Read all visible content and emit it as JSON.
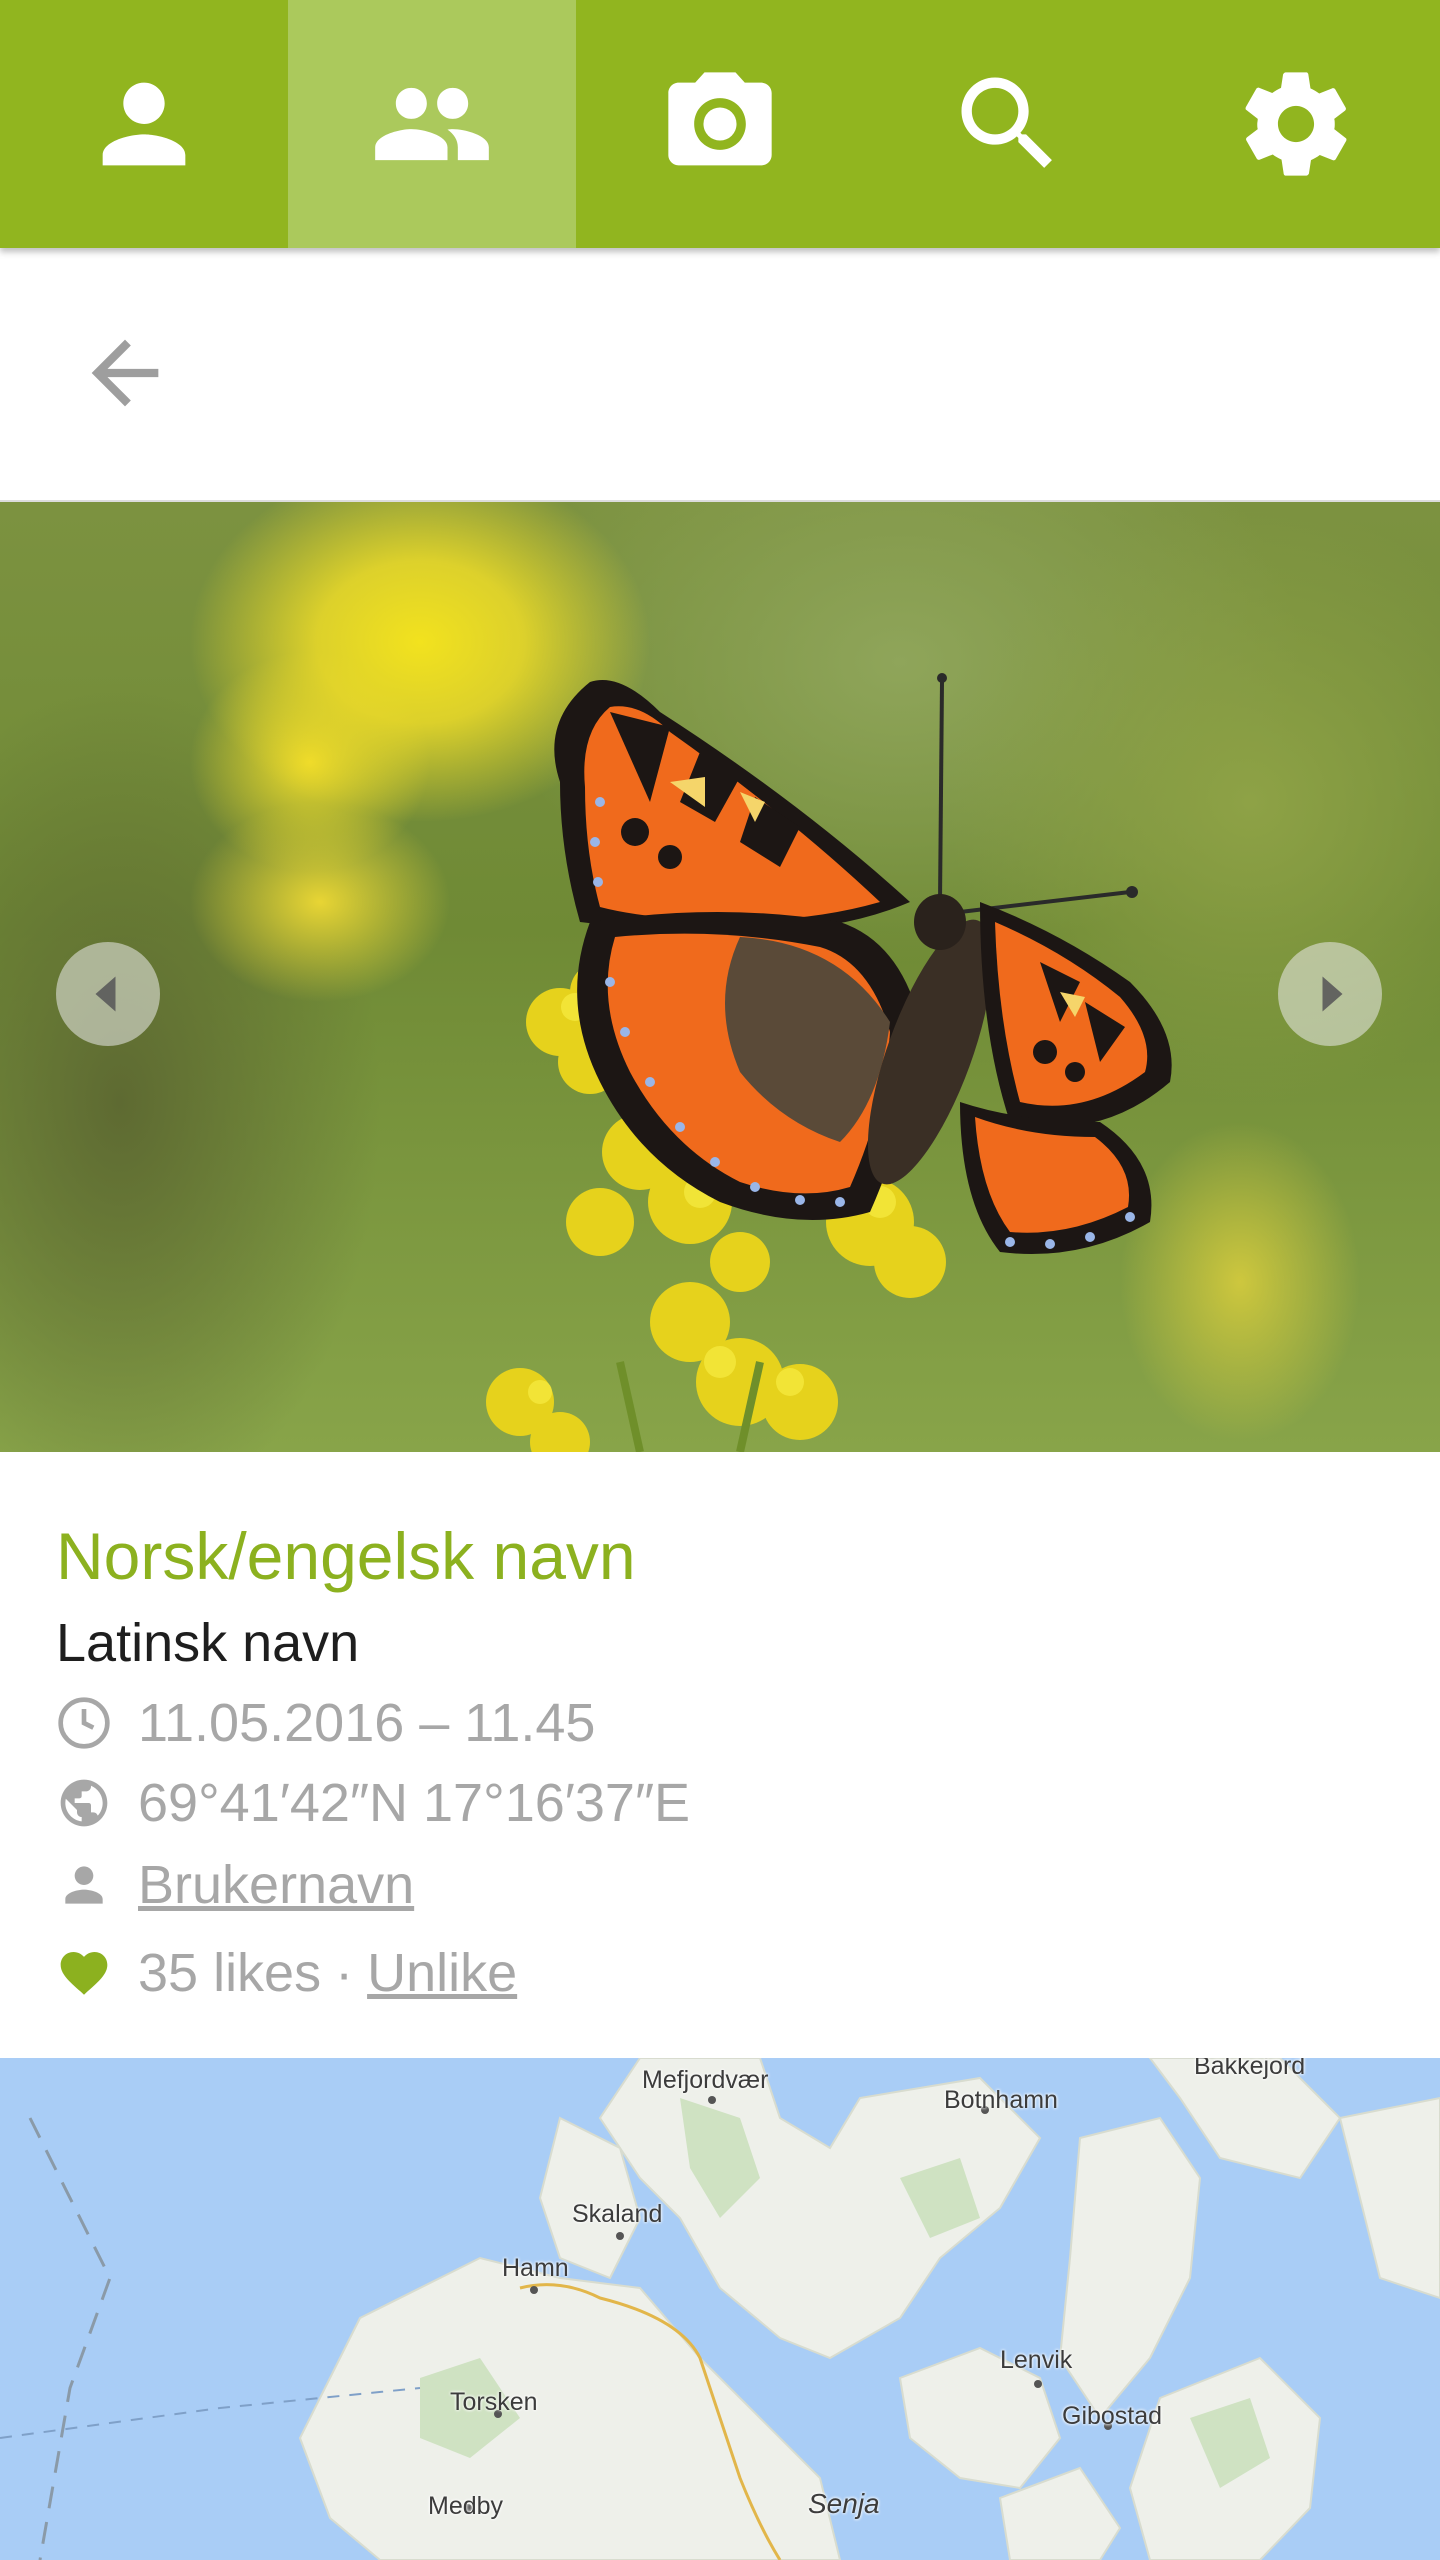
{
  "tabs": [
    {
      "name": "profile",
      "icon": "person-icon",
      "active": false
    },
    {
      "name": "community",
      "icon": "people-icon",
      "active": true
    },
    {
      "name": "camera",
      "icon": "camera-icon",
      "active": false
    },
    {
      "name": "search",
      "icon": "search-icon",
      "active": false
    },
    {
      "name": "settings",
      "icon": "gear-icon",
      "active": false
    }
  ],
  "colors": {
    "brand_green": "#91b51f",
    "tab_active": "#abc95c",
    "title_green": "#8cb11f",
    "meta_gray": "#a7a7a7",
    "like_green": "#8cb11f"
  },
  "toolbar": {
    "back_icon": "arrow-back-icon"
  },
  "gallery": {
    "image": "butterfly-photo",
    "prev_icon": "chevron-left-icon",
    "next_icon": "chevron-right-icon"
  },
  "observation": {
    "name": "Norsk/engelsk navn",
    "latin_name": "Latinsk navn",
    "datetime": "11.05.2016 – 11.45",
    "coordinates": "69°41′42″N 17°16′37″E",
    "username": "Brukernavn",
    "likes": "35 likes",
    "separator": "·",
    "unlike_label": "Unlike"
  },
  "map": {
    "places": [
      "Mefjordvær",
      "Botnhamn",
      "Bakkejord",
      "Skaland",
      "Hamn",
      "Lenvik",
      "Torsken",
      "Gibostad",
      "Medby",
      "Senja"
    ]
  }
}
